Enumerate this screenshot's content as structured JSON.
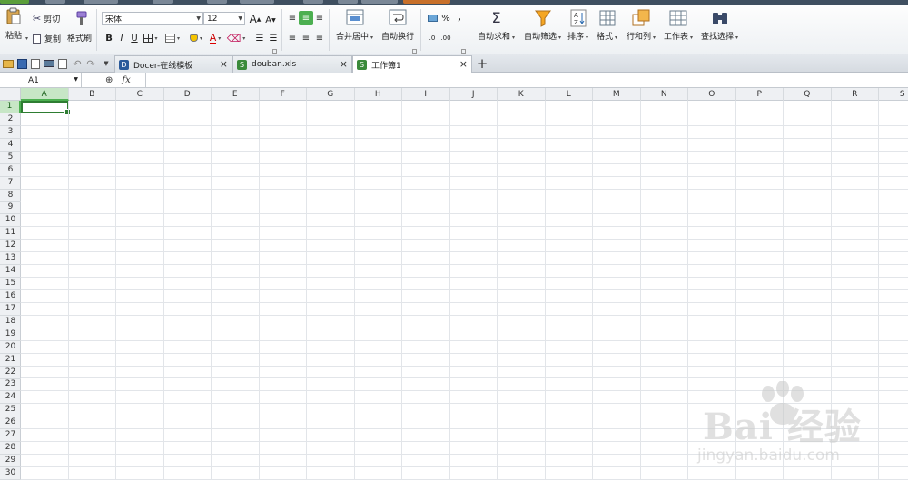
{
  "ribbon": {
    "paste": "粘贴",
    "cut": "剪切",
    "copy": "复制",
    "format_painter": "格式刷",
    "font_name": "宋体",
    "font_size": "12",
    "bold": "B",
    "italic": "I",
    "underline": "U",
    "font_color_letter": "A",
    "grow_font": "A",
    "shrink_font": "A",
    "merge_center": "合并居中",
    "wrap_text": "自动换行",
    "percent": "%",
    "thousands": ",",
    "autosum": "自动求和",
    "autofilter": "自动筛选",
    "sort": "排序",
    "format": "格式",
    "rows_cols": "行和列",
    "worksheet": "工作表",
    "find_select": "查找选择"
  },
  "tabs": [
    {
      "label": "Docer-在线模板",
      "active": false,
      "color": "#2a5a9a"
    },
    {
      "label": "douban.xls",
      "active": false,
      "color": "#3a8a3a"
    },
    {
      "label": "工作簿1",
      "active": true,
      "color": "#3a8a3a"
    }
  ],
  "formula": {
    "namebox": "A1",
    "fx": "fx",
    "value": ""
  },
  "columns": [
    "A",
    "B",
    "C",
    "D",
    "E",
    "F",
    "G",
    "H",
    "I",
    "J",
    "K",
    "L",
    "M",
    "N",
    "O",
    "P",
    "Q",
    "R",
    "S"
  ],
  "rows": [
    "1",
    "2",
    "3",
    "4",
    "5",
    "6",
    "7",
    "8",
    "9",
    "10",
    "11",
    "12",
    "13",
    "14",
    "15",
    "16",
    "17",
    "18",
    "19",
    "20",
    "21",
    "22",
    "23",
    "24",
    "25",
    "26",
    "27",
    "28",
    "29",
    "30"
  ],
  "selected_cell": {
    "col": "A",
    "row": "1"
  },
  "watermark": {
    "brand": "Bai 经验",
    "url": "jingyan.baidu.com"
  },
  "colors": {
    "accent": "#4caf50",
    "active_cell": "#2e7d32"
  }
}
